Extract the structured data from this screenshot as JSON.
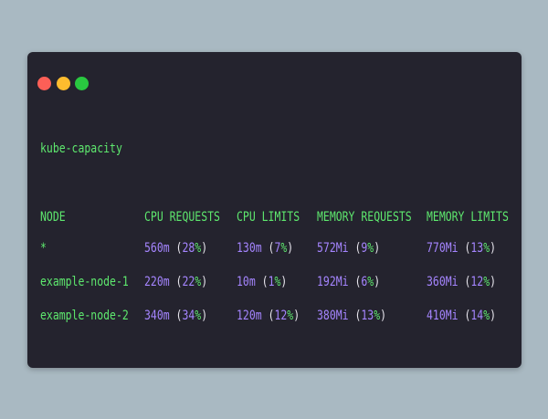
{
  "window": {
    "buttons": [
      "close",
      "minimize",
      "maximize"
    ],
    "colors": {
      "close": "#fd5f57",
      "minimize": "#febc2e",
      "maximize": "#29c840"
    }
  },
  "command": "kube-capacity",
  "table": {
    "headers": [
      "NODE",
      "CPU REQUESTS",
      "CPU LIMITS",
      "MEMORY REQUESTS",
      "MEMORY LIMITS"
    ],
    "rows": [
      {
        "node": "*",
        "cpu_requests": {
          "value": "560m",
          "pct": "28"
        },
        "cpu_limits": {
          "value": "130m",
          "pct": "7"
        },
        "memory_requests": {
          "value": "572Mi",
          "pct": "9"
        },
        "memory_limits": {
          "value": "770Mi",
          "pct": "13"
        }
      },
      {
        "node": "example-node-1",
        "cpu_requests": {
          "value": "220m",
          "pct": "22"
        },
        "cpu_limits": {
          "value": "10m",
          "pct": "1"
        },
        "memory_requests": {
          "value": "192Mi",
          "pct": "6"
        },
        "memory_limits": {
          "value": "360Mi",
          "pct": "12"
        }
      },
      {
        "node": "example-node-2",
        "cpu_requests": {
          "value": "340m",
          "pct": "34"
        },
        "cpu_limits": {
          "value": "120m",
          "pct": "12"
        },
        "memory_requests": {
          "value": "380Mi",
          "pct": "13"
        },
        "memory_limits": {
          "value": "410Mi",
          "pct": "14"
        }
      }
    ]
  },
  "colors": {
    "background": "#a9b9c2",
    "terminal_bg": "#24232e",
    "green_text": "#5ee86e",
    "purple_text": "#a585ff",
    "paren_text": "#e8e6ee"
  }
}
